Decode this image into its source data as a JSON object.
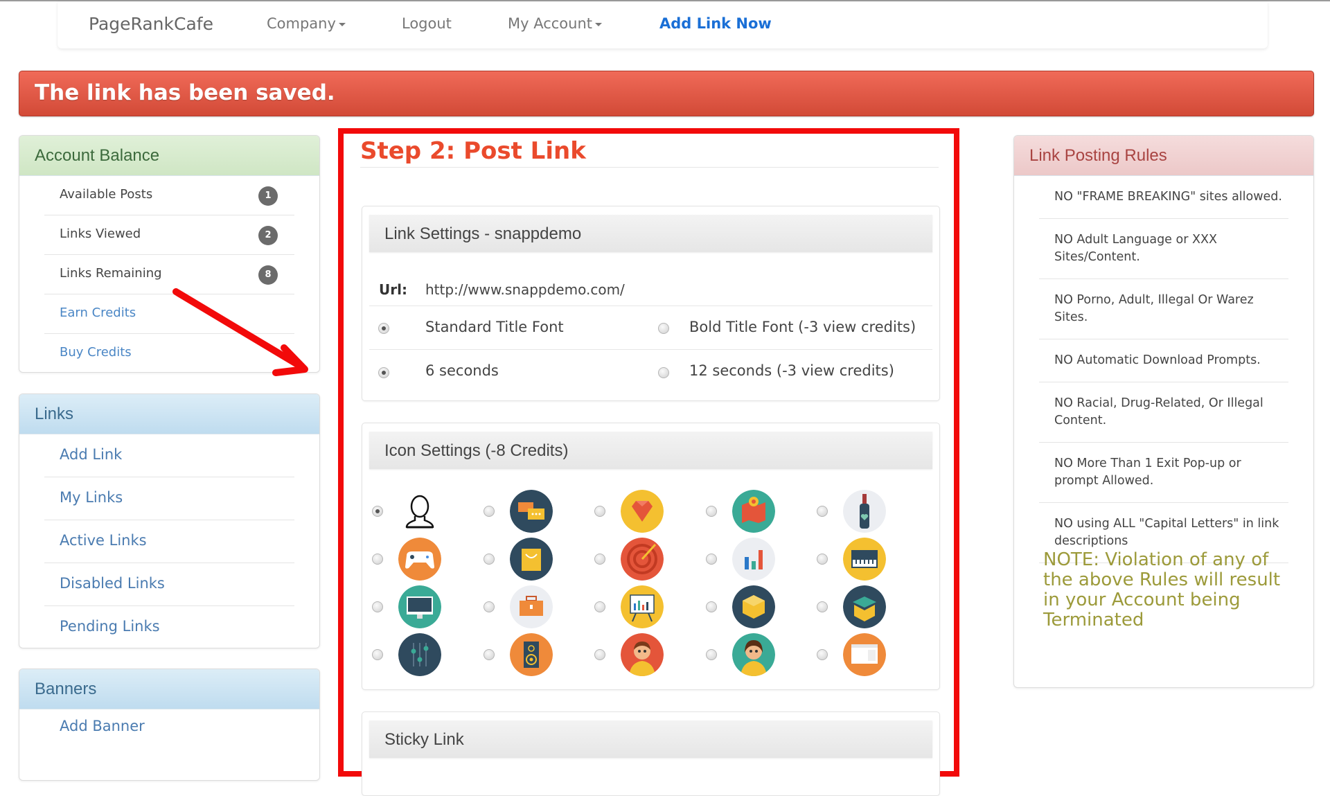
{
  "navbar": {
    "brand": "PageRankCafe",
    "items": [
      {
        "label": "Company",
        "dropdown": true
      },
      {
        "label": "Logout",
        "dropdown": false
      },
      {
        "label": "My Account",
        "dropdown": true
      }
    ],
    "cta": "Add Link Now"
  },
  "alert": {
    "message": "The link has been saved.",
    "color": "#e05a47"
  },
  "account_balance": {
    "title": "Account Balance",
    "stats": [
      {
        "label": "Available Posts",
        "value": "1"
      },
      {
        "label": "Links Viewed",
        "value": "2"
      },
      {
        "label": "Links Remaining",
        "value": "8"
      }
    ],
    "links": [
      "Earn Credits",
      "Buy Credits"
    ]
  },
  "links_panel": {
    "title": "Links",
    "items": [
      "Add Link",
      "My Links",
      "Active Links",
      "Disabled Links",
      "Pending Links"
    ]
  },
  "banners_panel": {
    "title": "Banners",
    "items": [
      "Add Banner"
    ]
  },
  "main": {
    "step_title": "Step 2: Post Link",
    "link_settings": {
      "title": "Link Settings - snappdemo",
      "url_label": "Url:",
      "url_value": "http://www.snappdemo.com/",
      "font_options": [
        {
          "label": "Standard Title Font",
          "selected": true
        },
        {
          "label": "Bold Title Font (-3 view credits)",
          "selected": false
        }
      ],
      "duration_options": [
        {
          "label": "6 seconds",
          "selected": true
        },
        {
          "label": "12 seconds (-3 view credits)",
          "selected": false
        }
      ]
    },
    "icon_settings": {
      "title": "Icon Settings (-8 Credits)",
      "selected_index": 0,
      "icons": [
        "default-user-icon",
        "chat-bubbles-icon",
        "diamond-icon",
        "map-pin-icon",
        "wine-bottle-icon",
        "gamepad-icon",
        "shopping-bag-icon",
        "target-icon",
        "bar-chart-icon",
        "synthesizer-icon",
        "monitor-icon",
        "briefcase-icon",
        "presentation-board-icon",
        "package-icon",
        "open-box-icon",
        "mixer-sliders-icon",
        "speaker-icon",
        "boy-avatar-icon",
        "girl-avatar-icon",
        "browser-window-icon"
      ]
    },
    "sticky_link": {
      "title": "Sticky Link"
    }
  },
  "rules_panel": {
    "title": "Link Posting Rules",
    "rules": [
      "NO \"FRAME BREAKING\" sites allowed.",
      "NO Adult Language or XXX Sites/Content.",
      "NO Porno, Adult, Illegal Or Warez Sites.",
      "NO Automatic Download Prompts.",
      "NO Racial, Drug-Related, Or Illegal Content.",
      "NO More Than 1 Exit Pop-up or prompt Allowed.",
      "NO using ALL \"Capital Letters\" in link descriptions"
    ],
    "note": "NOTE: Violation of any of the above Rules will result in your Account being Terminated"
  },
  "annotation": {
    "arrow_color": "#f20a0a",
    "highlight_color": "#f20a0a"
  }
}
